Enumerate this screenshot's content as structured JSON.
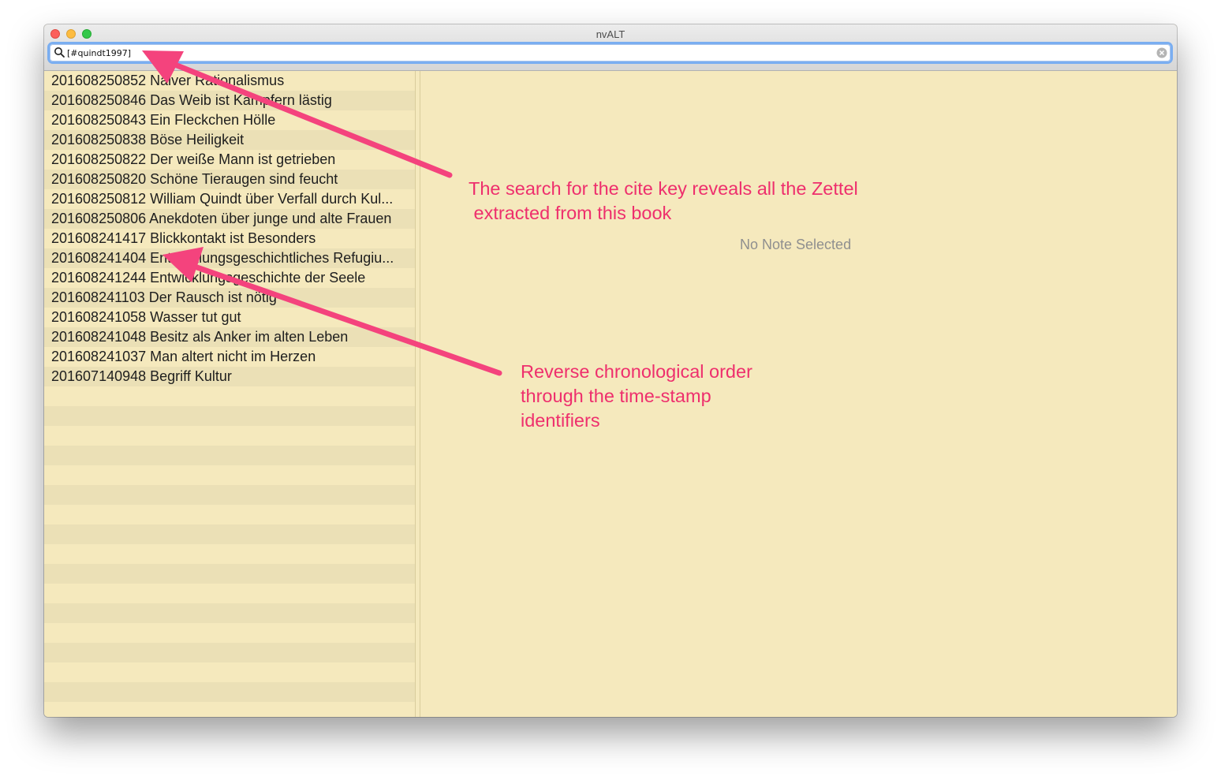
{
  "window": {
    "title": "nvALT"
  },
  "search": {
    "value": "[#quindt1997]",
    "placeholder": ""
  },
  "notes": [
    {
      "label": "201608250852 Naiver Rationalismus"
    },
    {
      "label": "201608250846 Das Weib ist Kämpfern lästig"
    },
    {
      "label": "201608250843 Ein Fleckchen Hölle"
    },
    {
      "label": "201608250838 Böse Heiligkeit"
    },
    {
      "label": "201608250822 Der weiße Mann ist getrieben"
    },
    {
      "label": "201608250820 Schöne Tieraugen sind feucht"
    },
    {
      "label": "201608250812 William Quindt über Verfall durch Kul..."
    },
    {
      "label": "201608250806 Anekdoten über junge und alte Frauen"
    },
    {
      "label": "201608241417 Blickkontakt ist Besonders"
    },
    {
      "label": "201608241404 Entwicklungsgeschichtliches Refugiu..."
    },
    {
      "label": "201608241244 Entwicklungsgeschichte der Seele"
    },
    {
      "label": "201608241103 Der Rausch ist nötig"
    },
    {
      "label": "201608241058 Wasser tut gut"
    },
    {
      "label": "201608241048 Besitz als Anker im alten Leben"
    },
    {
      "label": "201608241037 Man altert nicht im Herzen"
    },
    {
      "label": "201607140948 Begriff Kultur"
    }
  ],
  "editor": {
    "empty_text": "No Note Selected"
  },
  "annotations": {
    "search_note": "The search for the cite key reveals all the Zettel\n extracted from this book",
    "order_note": "Reverse chronological order\nthrough the time-stamp\nidentifiers"
  },
  "colors": {
    "background": "#f5e9bd",
    "stripe": "#ebe0b6",
    "annotation": "#ee2f6d",
    "arrow": "#f4437d"
  },
  "icons": {
    "search": "search-icon",
    "clear": "clear-search-icon",
    "close": "close-window-icon",
    "minimize": "minimize-window-icon",
    "zoom": "zoom-window-icon"
  }
}
